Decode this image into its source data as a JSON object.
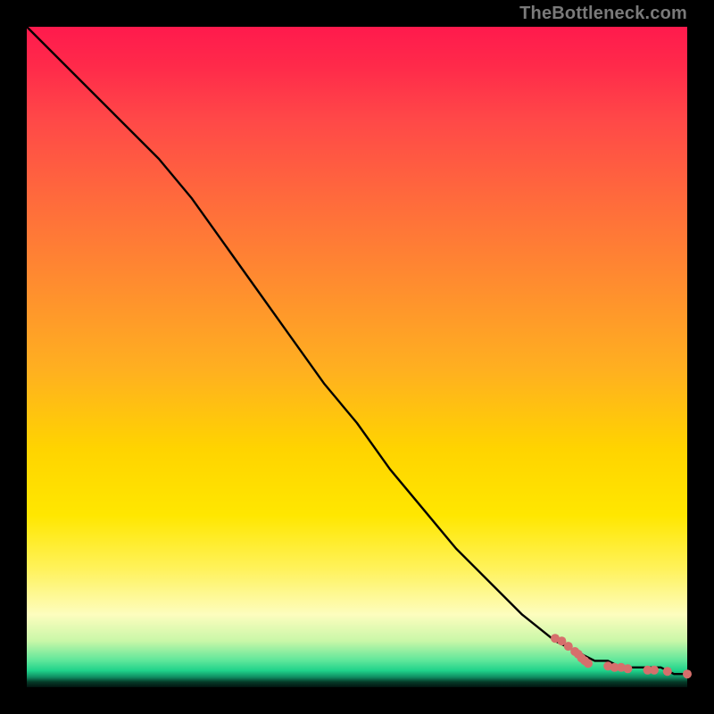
{
  "watermark": "TheBottleneck.com",
  "chart_data": {
    "type": "line",
    "title": "",
    "xlabel": "",
    "ylabel": "",
    "xlim": [
      0,
      100
    ],
    "ylim": [
      0,
      100
    ],
    "grid": false,
    "legend": false,
    "series": [
      {
        "name": "curve",
        "style": "line",
        "color": "#000000",
        "x": [
          0,
          5,
          10,
          15,
          20,
          25,
          30,
          35,
          40,
          45,
          50,
          55,
          60,
          65,
          70,
          75,
          80,
          82,
          84,
          86,
          88,
          90,
          92,
          94,
          96,
          98,
          100
        ],
        "y": [
          100,
          95,
          90,
          85,
          80,
          74,
          67,
          60,
          53,
          46,
          40,
          33,
          27,
          21,
          16,
          11,
          7,
          6,
          5,
          4,
          4,
          3,
          3,
          3,
          3,
          2,
          2
        ]
      },
      {
        "name": "points",
        "style": "scatter",
        "color": "#d66f6c",
        "x": [
          80,
          81,
          82,
          83,
          83.5,
          84,
          84.5,
          85,
          88,
          89,
          90,
          91,
          94,
          95,
          97,
          100
        ],
        "y": [
          7.4,
          7.0,
          6.2,
          5.4,
          5.0,
          4.4,
          4.0,
          3.6,
          3.2,
          3.0,
          3.0,
          2.8,
          2.6,
          2.6,
          2.4,
          2.0
        ]
      }
    ]
  }
}
